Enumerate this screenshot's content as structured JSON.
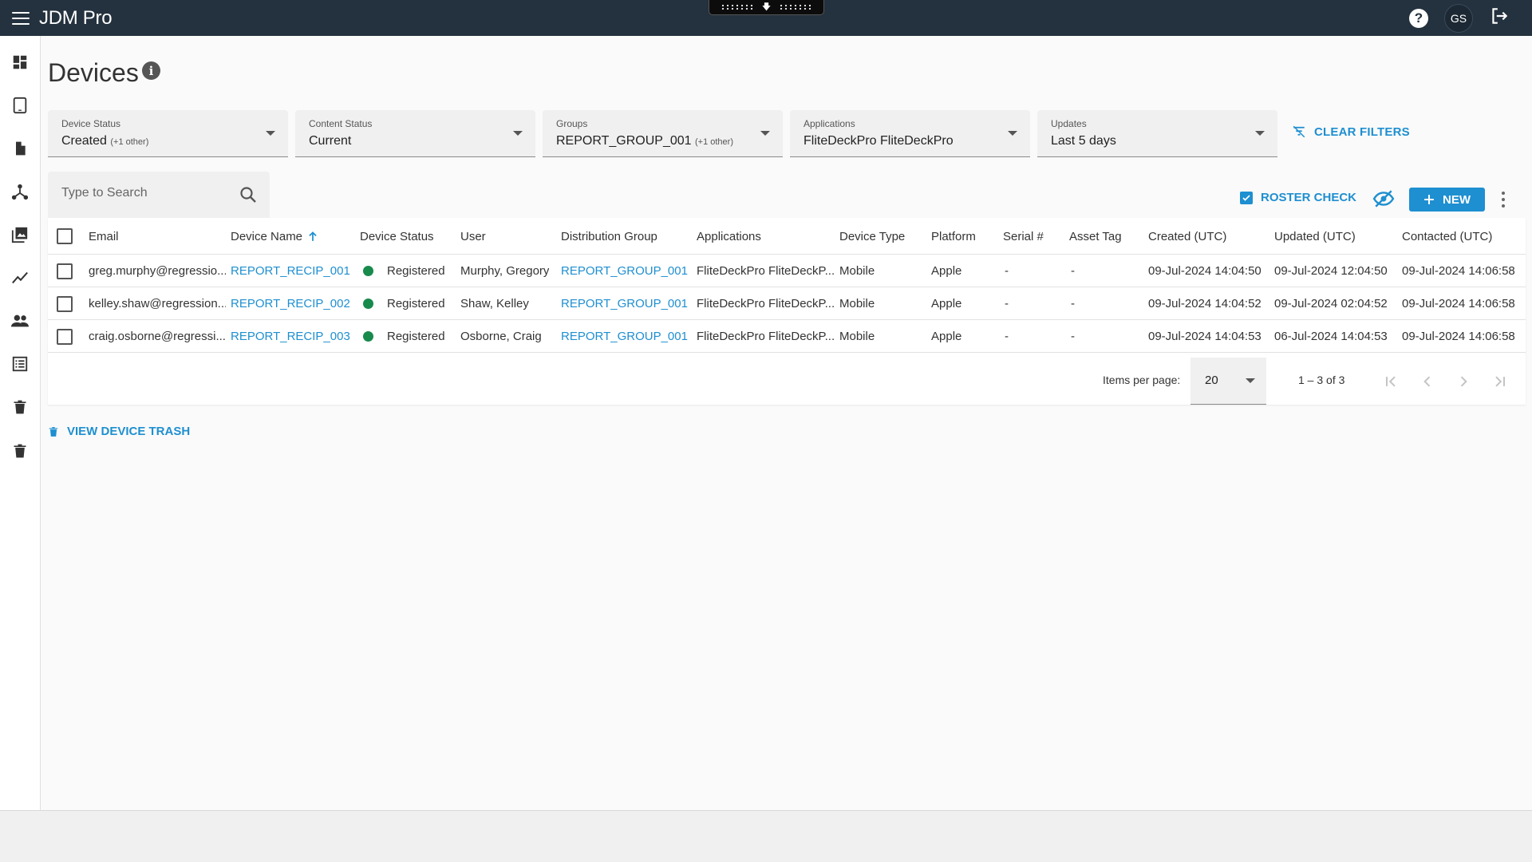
{
  "app": {
    "title": "JDM Pro",
    "user_initials": "GS"
  },
  "icons": {
    "menu": "hamburger-menu-icon",
    "help": "help-icon",
    "logout": "logout-icon",
    "sidebar": [
      "dashboard-icon",
      "tablet-icon",
      "document-icon",
      "hub-icon",
      "images-icon",
      "analytics-icon",
      "users-icon",
      "list-icon",
      "trash-icon",
      "trash-icon"
    ]
  },
  "page": {
    "title": "Devices"
  },
  "filters": [
    {
      "label": "Device Status",
      "value": "Created",
      "extra": "(+1 other)"
    },
    {
      "label": "Content Status",
      "value": "Current",
      "extra": ""
    },
    {
      "label": "Groups",
      "value": "REPORT_GROUP_001",
      "extra": "(+1 other)"
    },
    {
      "label": "Applications",
      "value": "FliteDeckPro FliteDeckPro",
      "extra": ""
    },
    {
      "label": "Updates",
      "value": "Last 5 days",
      "extra": ""
    }
  ],
  "actions": {
    "clear_filters": "CLEAR FILTERS",
    "roster_check": "ROSTER CHECK",
    "new": "NEW",
    "view_trash": "VIEW DEVICE TRASH"
  },
  "search": {
    "placeholder": "Type to Search"
  },
  "table": {
    "columns": [
      "Email",
      "Device Name",
      "Device Status",
      "User",
      "Distribution Group",
      "Applications",
      "Device Type",
      "Platform",
      "Serial #",
      "Asset Tag",
      "Created (UTC)",
      "Updated (UTC)",
      "Contacted (UTC)"
    ],
    "rows": [
      {
        "email": "greg.murphy@regressio...",
        "device_name": "REPORT_RECIP_001",
        "status": "Registered",
        "user": "Murphy, Gregory",
        "group": "REPORT_GROUP_001",
        "applications": "FliteDeckPro FliteDeckP...",
        "device_type": "Mobile",
        "platform": "Apple",
        "serial": "-",
        "asset_tag": "-",
        "created": "09-Jul-2024 14:04:50",
        "updated": "09-Jul-2024 12:04:50",
        "contacted": "09-Jul-2024 14:06:58"
      },
      {
        "email": "kelley.shaw@regression...",
        "device_name": "REPORT_RECIP_002",
        "status": "Registered",
        "user": "Shaw, Kelley",
        "group": "REPORT_GROUP_001",
        "applications": "FliteDeckPro FliteDeckP...",
        "device_type": "Mobile",
        "platform": "Apple",
        "serial": "-",
        "asset_tag": "-",
        "created": "09-Jul-2024 14:04:52",
        "updated": "09-Jul-2024 02:04:52",
        "contacted": "09-Jul-2024 14:06:58"
      },
      {
        "email": "craig.osborne@regressi...",
        "device_name": "REPORT_RECIP_003",
        "status": "Registered",
        "user": "Osborne, Craig",
        "group": "REPORT_GROUP_001",
        "applications": "FliteDeckPro FliteDeckP...",
        "device_type": "Mobile",
        "platform": "Apple",
        "serial": "-",
        "asset_tag": "-",
        "created": "09-Jul-2024 14:04:53",
        "updated": "06-Jul-2024 14:04:53",
        "contacted": "09-Jul-2024 14:06:58"
      }
    ]
  },
  "pagination": {
    "items_per_page_label": "Items per page:",
    "items_per_page": "20",
    "range": "1 – 3 of 3"
  },
  "colors": {
    "topbar": "#24313e",
    "accent": "#1e8fd0",
    "status_registered": "#178a4c"
  }
}
